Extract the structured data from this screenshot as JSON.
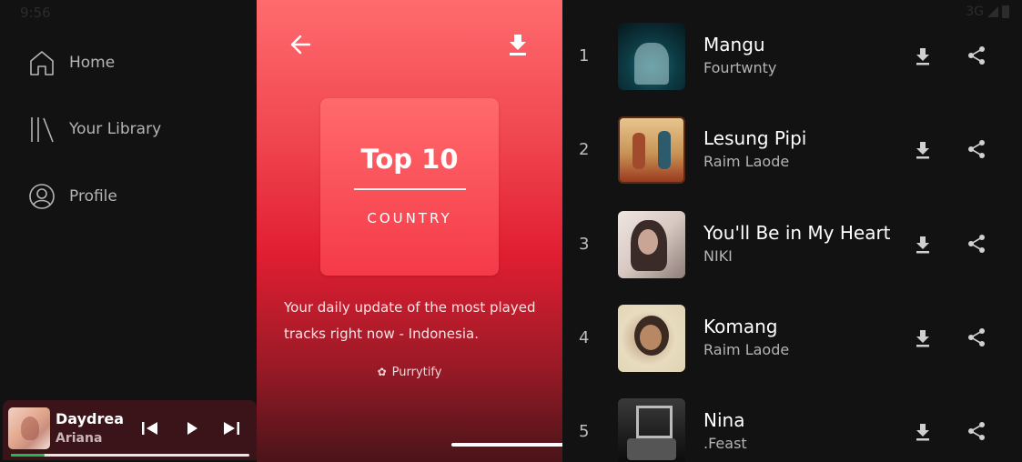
{
  "status": {
    "time": "9:56",
    "network": "3G"
  },
  "sidebar": {
    "items": [
      {
        "label": "Home",
        "icon": "home-icon"
      },
      {
        "label": "Your Library",
        "icon": "library-icon"
      },
      {
        "label": "Profile",
        "icon": "profile-icon"
      }
    ]
  },
  "player": {
    "title": "Daydrea",
    "artist": "Ariana",
    "progress": 0.14,
    "accent": "#1db954"
  },
  "playlist": {
    "cover_title": "Top 10",
    "cover_subtitle": "COUNTRY",
    "description": "Your daily update of the most played tracks right now - Indonesia.",
    "owner": "Purrytify",
    "gradient_top": "#ff6b6e",
    "gradient_bottom": "#4a1419"
  },
  "tracks": [
    {
      "num": "1",
      "title": "Mangu",
      "artist": "Fourtwnty"
    },
    {
      "num": "2",
      "title": "Lesung Pipi",
      "artist": "Raim Laode"
    },
    {
      "num": "3",
      "title": "You'll Be in My Heart",
      "artist": "NIKI"
    },
    {
      "num": "4",
      "title": "Komang",
      "artist": "Raim Laode"
    },
    {
      "num": "5",
      "title": "Nina",
      "artist": ".Feast"
    }
  ]
}
